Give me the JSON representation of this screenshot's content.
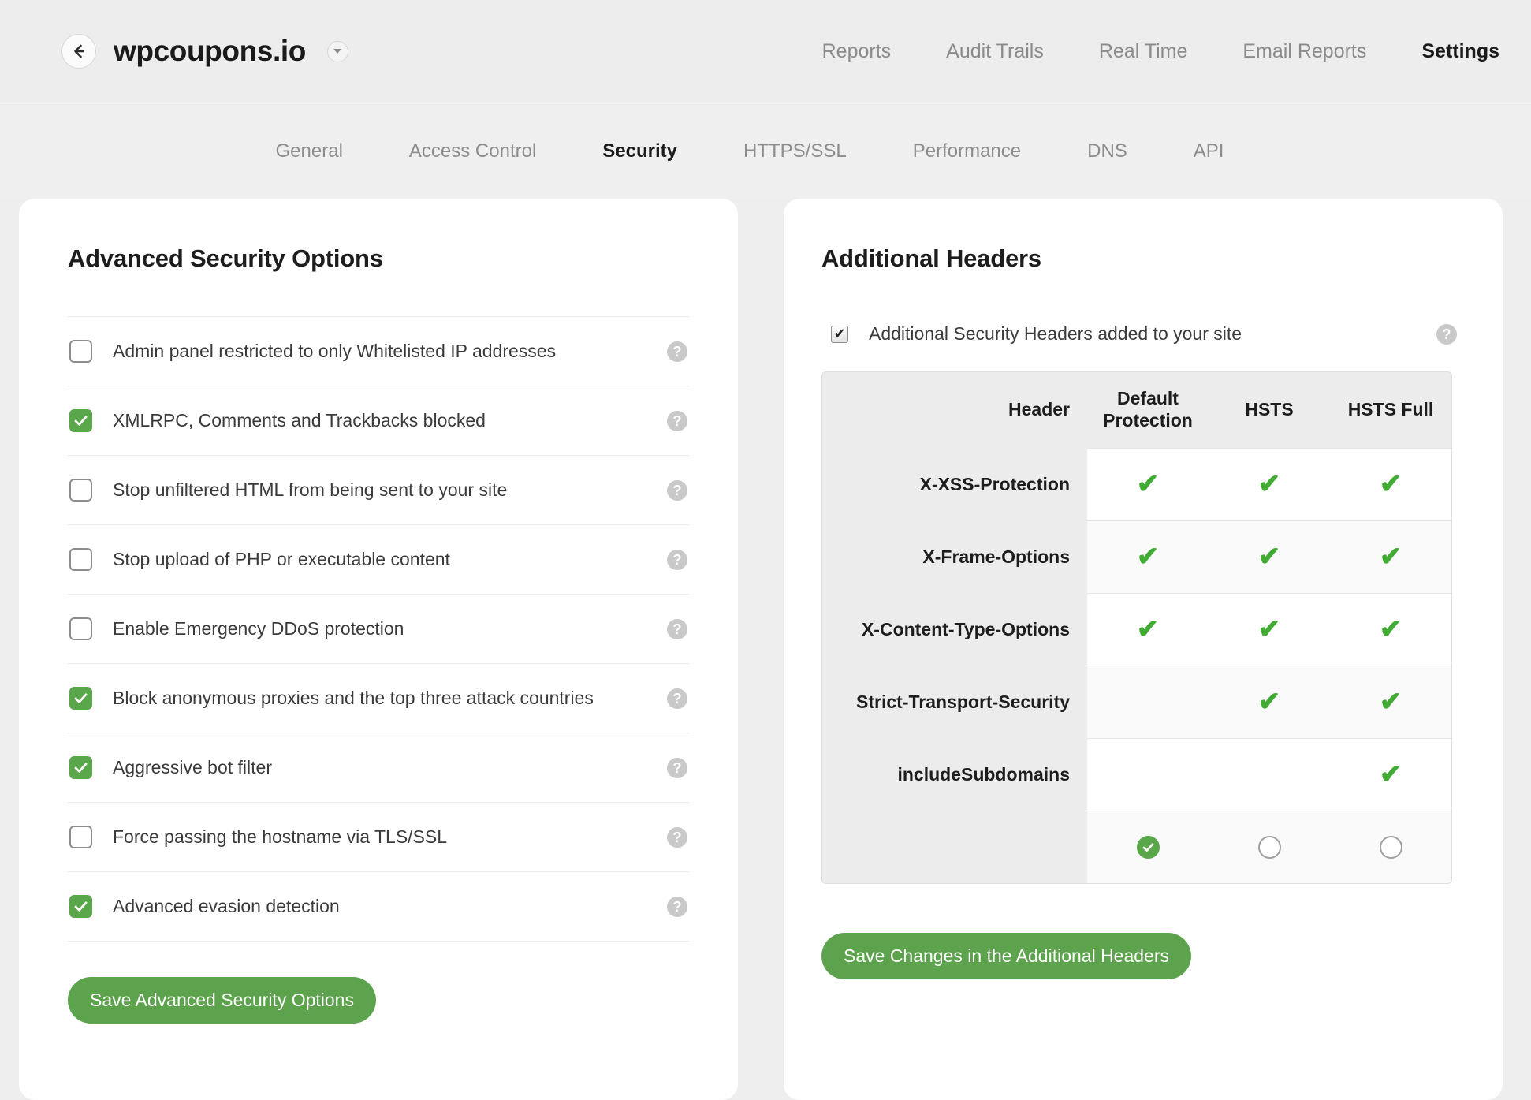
{
  "header": {
    "back_icon": "arrow-left-icon",
    "site_name": "wpcoupons.io",
    "site_dropdown_icon": "chevron-down-icon",
    "nav": [
      {
        "label": "Reports",
        "active": false
      },
      {
        "label": "Audit Trails",
        "active": false
      },
      {
        "label": "Real Time",
        "active": false
      },
      {
        "label": "Email Reports",
        "active": false
      },
      {
        "label": "Settings",
        "active": true
      }
    ]
  },
  "subnav": [
    {
      "label": "General",
      "active": false
    },
    {
      "label": "Access Control",
      "active": false
    },
    {
      "label": "Security",
      "active": true
    },
    {
      "label": "HTTPS/SSL",
      "active": false
    },
    {
      "label": "Performance",
      "active": false
    },
    {
      "label": "DNS",
      "active": false
    },
    {
      "label": "API",
      "active": false
    }
  ],
  "left_panel": {
    "title": "Advanced Security Options",
    "help_icon": "question-mark-icon",
    "options": [
      {
        "label": "Admin panel restricted to only Whitelisted IP addresses",
        "checked": false
      },
      {
        "label": "XMLRPC, Comments and Trackbacks blocked",
        "checked": true
      },
      {
        "label": "Stop unfiltered HTML from being sent to your site",
        "checked": false
      },
      {
        "label": "Stop upload of PHP or executable content",
        "checked": false
      },
      {
        "label": "Enable Emergency DDoS protection",
        "checked": false
      },
      {
        "label": "Block anonymous proxies and the top three attack countries",
        "checked": true
      },
      {
        "label": "Aggressive bot filter",
        "checked": true
      },
      {
        "label": "Force passing the hostname via TLS/SSL",
        "checked": false
      },
      {
        "label": "Advanced evasion detection",
        "checked": true
      }
    ],
    "save_label": "Save Advanced Security Options"
  },
  "right_panel": {
    "title": "Additional Headers",
    "toggle": {
      "label": "Additional Security Headers added to your site",
      "checked": true,
      "help_icon": "question-mark-icon"
    },
    "table": {
      "columns": [
        "Header",
        "Default Protection",
        "HSTS",
        "HSTS Full"
      ],
      "rows": [
        {
          "name": "X-XSS-Protection",
          "values": [
            true,
            true,
            true
          ]
        },
        {
          "name": "X-Frame-Options",
          "values": [
            true,
            true,
            true
          ]
        },
        {
          "name": "X-Content-Type-Options",
          "values": [
            true,
            true,
            true
          ]
        },
        {
          "name": "Strict-Transport-Security",
          "values": [
            false,
            true,
            true
          ]
        },
        {
          "name": "includeSubdomains",
          "values": [
            false,
            false,
            true
          ]
        }
      ],
      "selection": {
        "selected_index": 0,
        "options": [
          "Default Protection",
          "HSTS",
          "HSTS Full"
        ]
      }
    },
    "save_label": "Save Changes in the Additional Headers"
  },
  "colors": {
    "accent_green": "#5aa64b",
    "check_green": "#41ab34",
    "page_bg": "#eeeeee",
    "card_bg": "#ffffff",
    "text_dark": "#1d1d1d",
    "text_muted": "#8b8b8b"
  }
}
